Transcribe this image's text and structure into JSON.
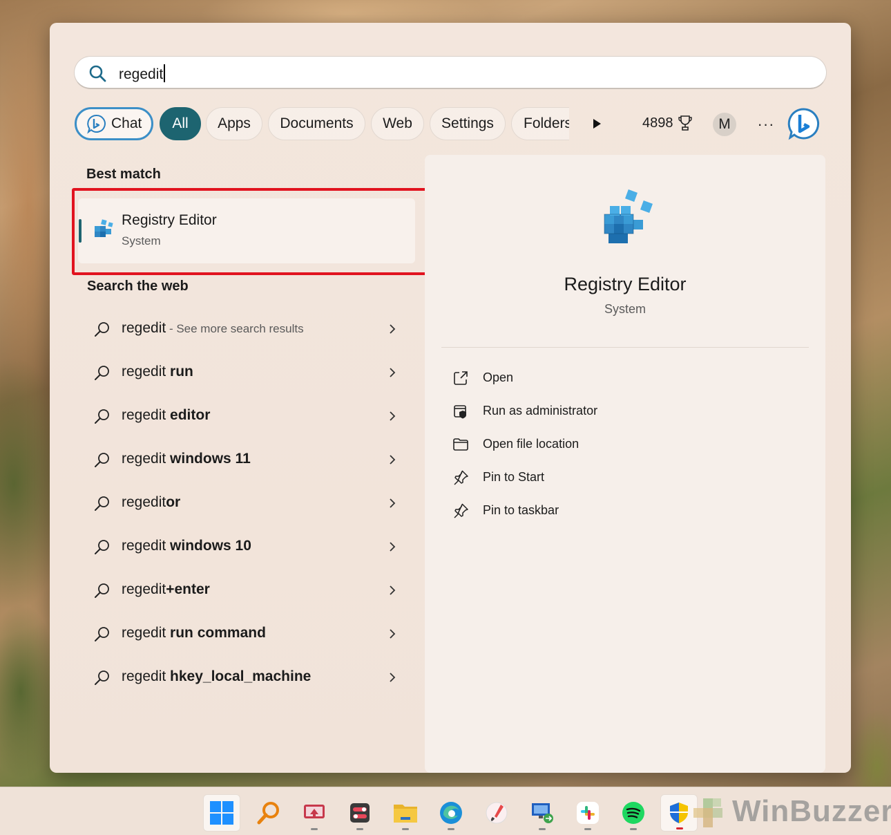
{
  "search": {
    "query": "regedit"
  },
  "filters": {
    "chat": "Chat",
    "all": "All",
    "apps": "Apps",
    "documents": "Documents",
    "web": "Web",
    "settings": "Settings",
    "folders": "Folders"
  },
  "header": {
    "points": "4898",
    "avatar_initial": "M",
    "more": "···"
  },
  "best_match": {
    "heading": "Best match",
    "title": "Registry Editor",
    "subtitle": "System"
  },
  "web_search": {
    "heading": "Search the web",
    "items": [
      {
        "query": "regedit",
        "suffix": "",
        "note": " - See more search results"
      },
      {
        "query": "regedit",
        "suffix": " run",
        "note": ""
      },
      {
        "query": "regedit",
        "suffix": " editor",
        "note": ""
      },
      {
        "query": "regedit",
        "suffix": " windows 11",
        "note": ""
      },
      {
        "query": "regedit",
        "suffix": "or",
        "note": ""
      },
      {
        "query": "regedit",
        "suffix": " windows 10",
        "note": ""
      },
      {
        "query": "regedit",
        "suffix": "+enter",
        "note": ""
      },
      {
        "query": "regedit",
        "suffix": " run command",
        "note": ""
      },
      {
        "query": "regedit",
        "suffix": " hkey_local_machine",
        "note": ""
      }
    ]
  },
  "details": {
    "title": "Registry Editor",
    "subtitle": "System",
    "actions": [
      {
        "label": "Open",
        "icon": "open-external-icon"
      },
      {
        "label": "Run as administrator",
        "icon": "shield-admin-icon"
      },
      {
        "label": "Open file location",
        "icon": "folder-icon"
      },
      {
        "label": "Pin to Start",
        "icon": "pin-icon"
      },
      {
        "label": "Pin to taskbar",
        "icon": "pin-icon"
      }
    ]
  },
  "watermark": "WinBuzzer",
  "colors": {
    "accent": "#1d6470",
    "highlight": "#e1131f",
    "bing_blue": "#3c8fc7"
  }
}
